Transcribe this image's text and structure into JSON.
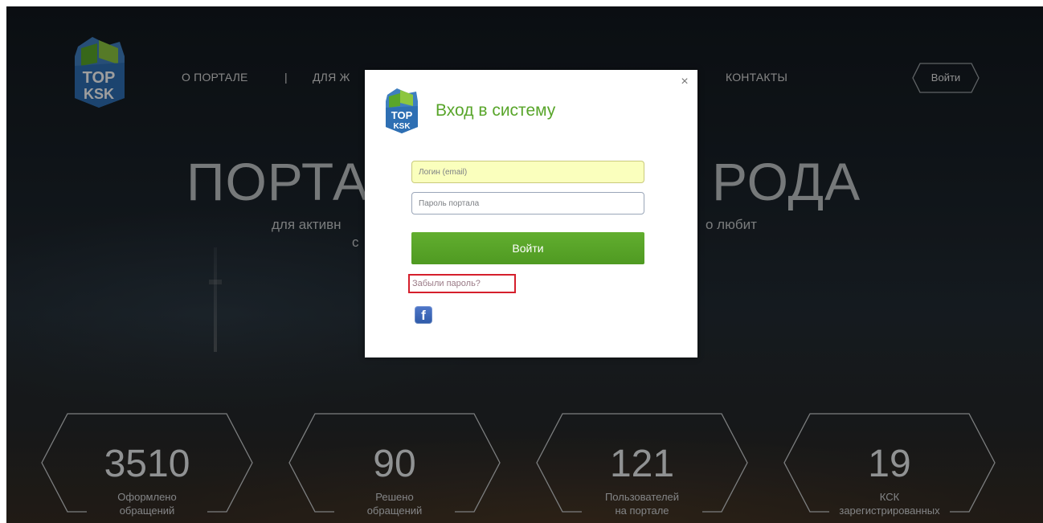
{
  "header": {
    "logo_text_top": "TOP",
    "logo_text_bottom": "KSK",
    "nav": [
      "О ПОРТАЛЕ",
      "|",
      "ДЛЯ Ж",
      "КОНТАКТЫ"
    ],
    "login_label": "Войти"
  },
  "hero": {
    "title_left": "ПОРТА",
    "title_right": "РОДА",
    "sub_left": "для активн",
    "sub_right": "о любит",
    "sub_line2": "с"
  },
  "stats": [
    {
      "value": "3510",
      "label_line1": "Оформлено",
      "label_line2": "обращений"
    },
    {
      "value": "90",
      "label_line1": "Решено",
      "label_line2": "обращений"
    },
    {
      "value": "121",
      "label_line1": "Пользователей",
      "label_line2": "на портале"
    },
    {
      "value": "19",
      "label_line1": "КСК",
      "label_line2": "зарегистрированных"
    }
  ],
  "modal": {
    "close_glyph": "×",
    "title": "Вход в систему",
    "email_placeholder": "Логин (email)",
    "password_placeholder": "Пароль портала",
    "submit_label": "Войти",
    "forgot_label": "Забыли пароль?",
    "facebook_glyph": "f"
  },
  "colors": {
    "accent_green": "#5aa62a",
    "highlight_red": "#d51f2c",
    "autofill_yellow": "#faffbd",
    "facebook_blue": "#3b5998"
  }
}
